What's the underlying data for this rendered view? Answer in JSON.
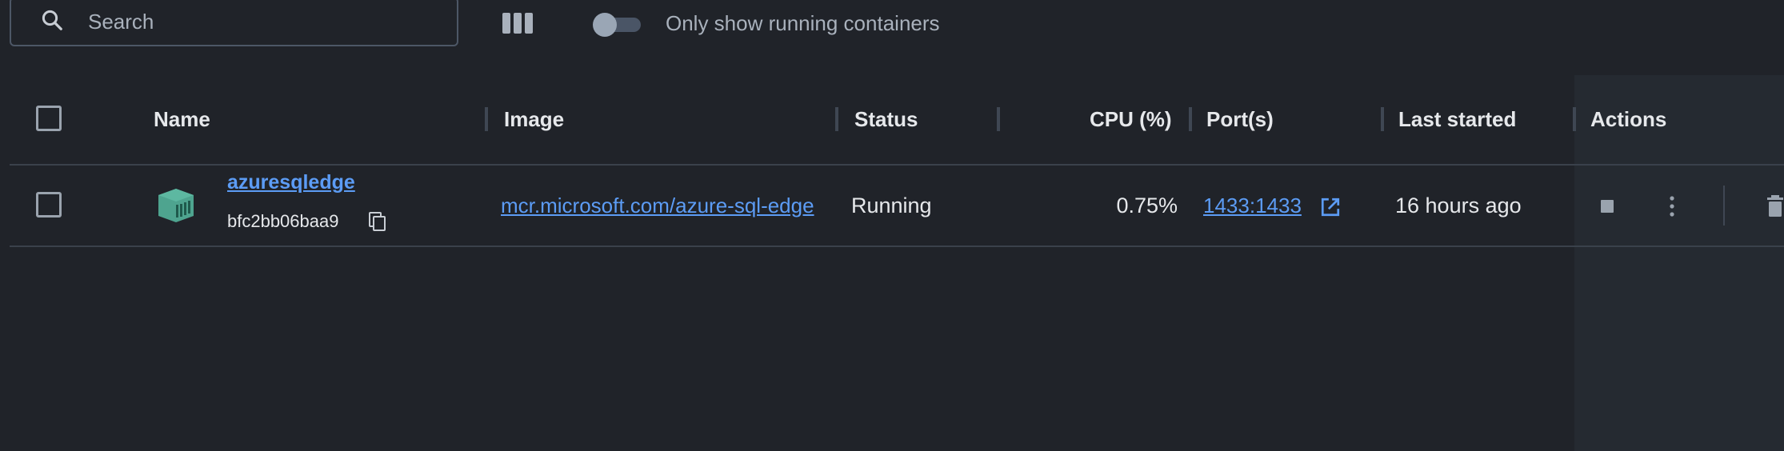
{
  "toolbar": {
    "search": {
      "placeholder": "Search",
      "value": ""
    },
    "columns_icon": "columns-icon",
    "toggle": {
      "label": "Only show running containers",
      "on": false
    }
  },
  "table": {
    "columns": {
      "name": "Name",
      "image": "Image",
      "status": "Status",
      "cpu": "CPU (%)",
      "ports": "Port(s)",
      "last_started": "Last started",
      "actions": "Actions"
    },
    "rows": [
      {
        "name": "azuresqledge",
        "id": "bfc2bb06baa9",
        "image": "mcr.microsoft.com/azure-sql-edge",
        "status": "Running",
        "cpu": "0.75%",
        "ports": "1433:1433",
        "last_started": "16 hours ago"
      }
    ]
  },
  "colors": {
    "background": "#202329",
    "link": "#5c9cf5",
    "container_icon": "#4ea48f"
  }
}
